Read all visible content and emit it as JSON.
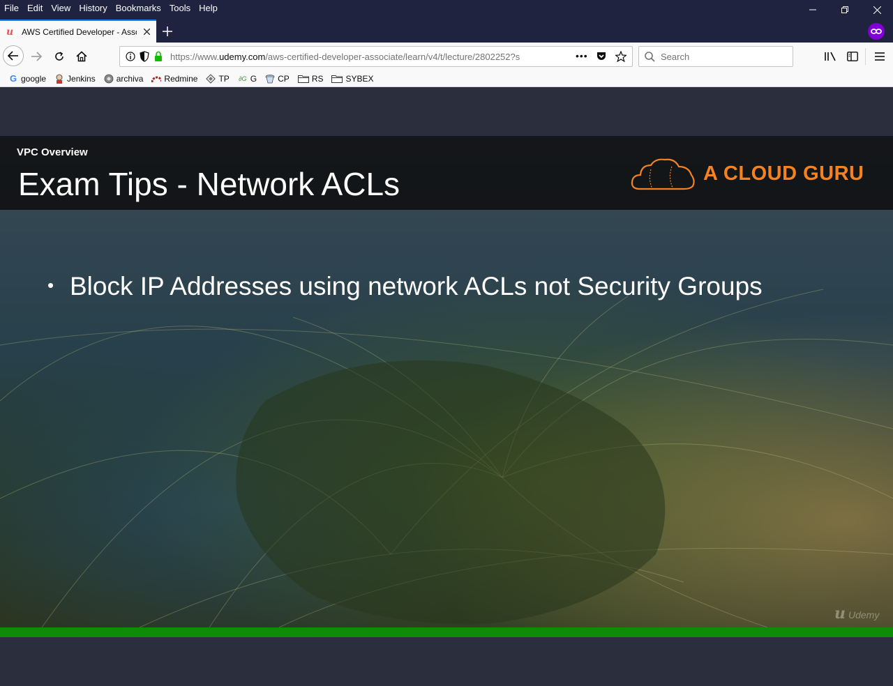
{
  "menu": [
    "File",
    "Edit",
    "View",
    "History",
    "Bookmarks",
    "Tools",
    "Help"
  ],
  "tab": {
    "title": "AWS Certified Developer - Associa",
    "favicon": "udemy-icon"
  },
  "nav": {
    "url_prefix": "https://www.",
    "url_domain": "udemy.com",
    "url_path": "/aws-certified-developer-associate/learn/v4/t/lecture/2802252?s",
    "search_placeholder": "Search"
  },
  "bookmarks": [
    {
      "label": "google",
      "icon": "google-icon"
    },
    {
      "label": "Jenkins",
      "icon": "jenkins-icon"
    },
    {
      "label": "archiva",
      "icon": "archiva-icon"
    },
    {
      "label": "Redmine",
      "icon": "redmine-icon"
    },
    {
      "label": "TP",
      "icon": "tp-icon"
    },
    {
      "label": "G",
      "icon": "g-icon"
    },
    {
      "label": "CP",
      "icon": "cp-icon"
    },
    {
      "label": "RS",
      "icon": "folder-icon"
    },
    {
      "label": "SYBEX",
      "icon": "folder-icon"
    }
  ],
  "slide": {
    "section": "VPC Overview",
    "title": "Exam Tips - Network ACLs",
    "brand": "A CLOUD GURU",
    "bullet": "Block IP Addresses using network ACLs not Security Groups",
    "watermark": "Udemy"
  },
  "colors": {
    "brand_orange": "#f58220",
    "progress_green": "#0e8b07",
    "accent_blue": "#0a84ff",
    "private_purple": "#8000d7"
  },
  "video": {
    "progress_fraction": 1.0
  }
}
